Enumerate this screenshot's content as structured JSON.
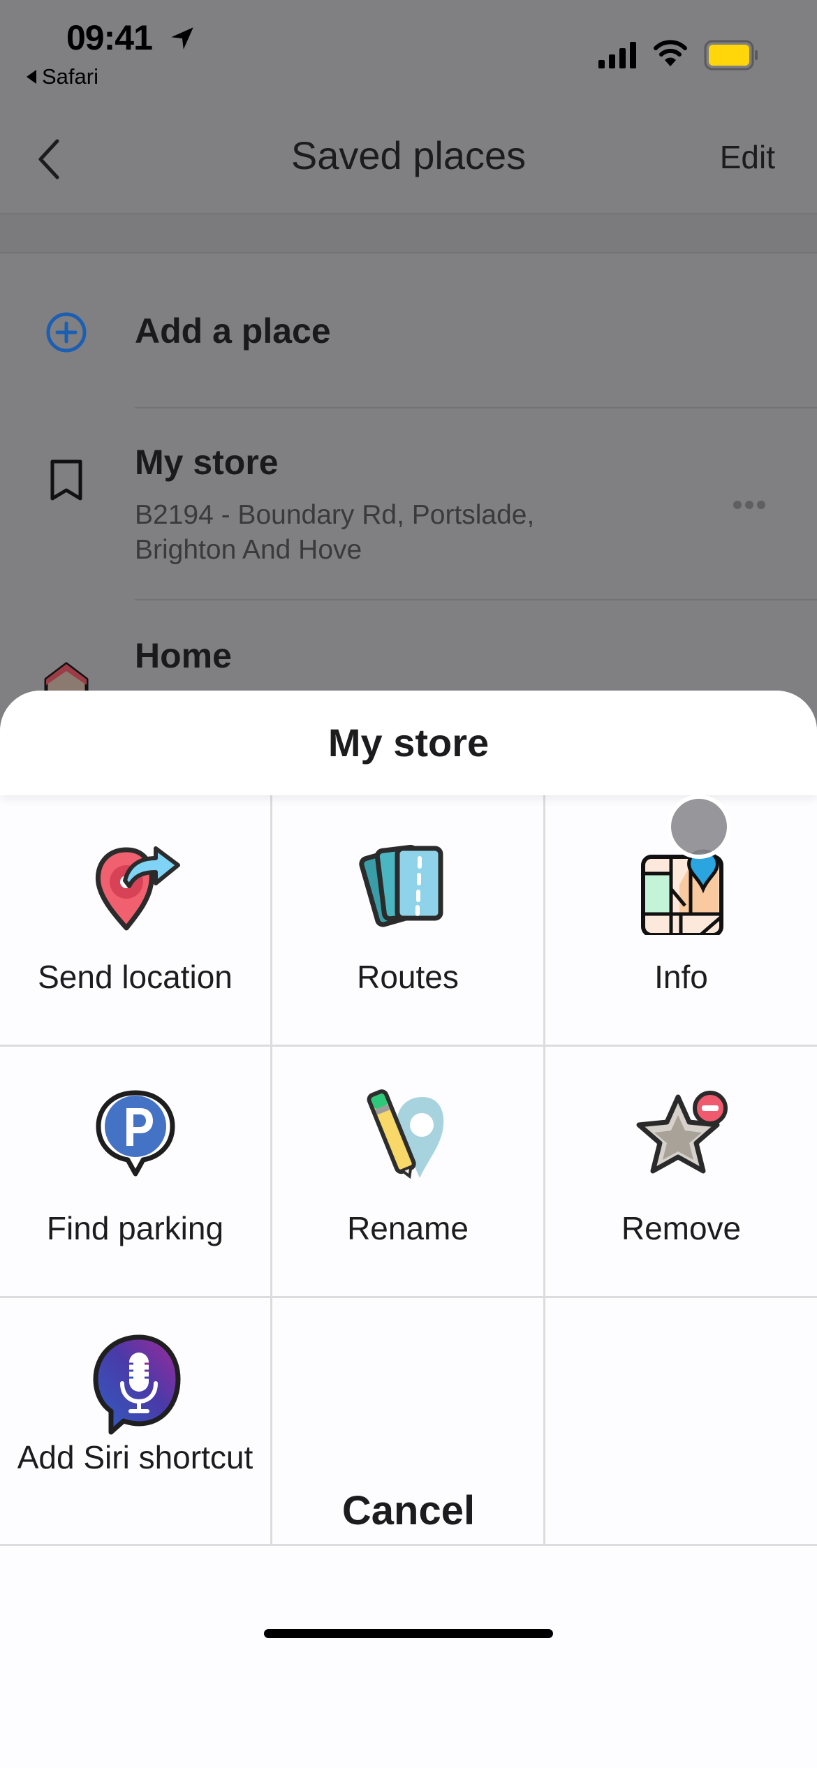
{
  "status_bar": {
    "time": "09:41",
    "back_app": "Safari",
    "battery_color": "#ffd60a"
  },
  "nav": {
    "title": "Saved places",
    "edit_label": "Edit"
  },
  "list": {
    "add_place": "Add a place",
    "items": [
      {
        "title": "My store",
        "address": "B2194 - Boundary Rd, Portslade, Brighton And Hove"
      },
      {
        "title": "Home"
      }
    ]
  },
  "sheet": {
    "title": "My store",
    "actions": [
      {
        "label": "Send location",
        "icon": "send-location-icon"
      },
      {
        "label": "Routes",
        "icon": "routes-icon"
      },
      {
        "label": "Info",
        "icon": "info-map-icon"
      },
      {
        "label": "Find parking",
        "icon": "parking-icon"
      },
      {
        "label": "Rename",
        "icon": "rename-pencil-icon"
      },
      {
        "label": "Remove",
        "icon": "remove-star-icon"
      },
      {
        "label": "Add Siri shortcut",
        "icon": "siri-microphone-icon"
      }
    ],
    "cancel_label": "Cancel"
  },
  "colors": {
    "accent_blue": "#1a5fb4",
    "dim_overlay": "#807f82",
    "sheet_bg": "#fdfcfe"
  }
}
